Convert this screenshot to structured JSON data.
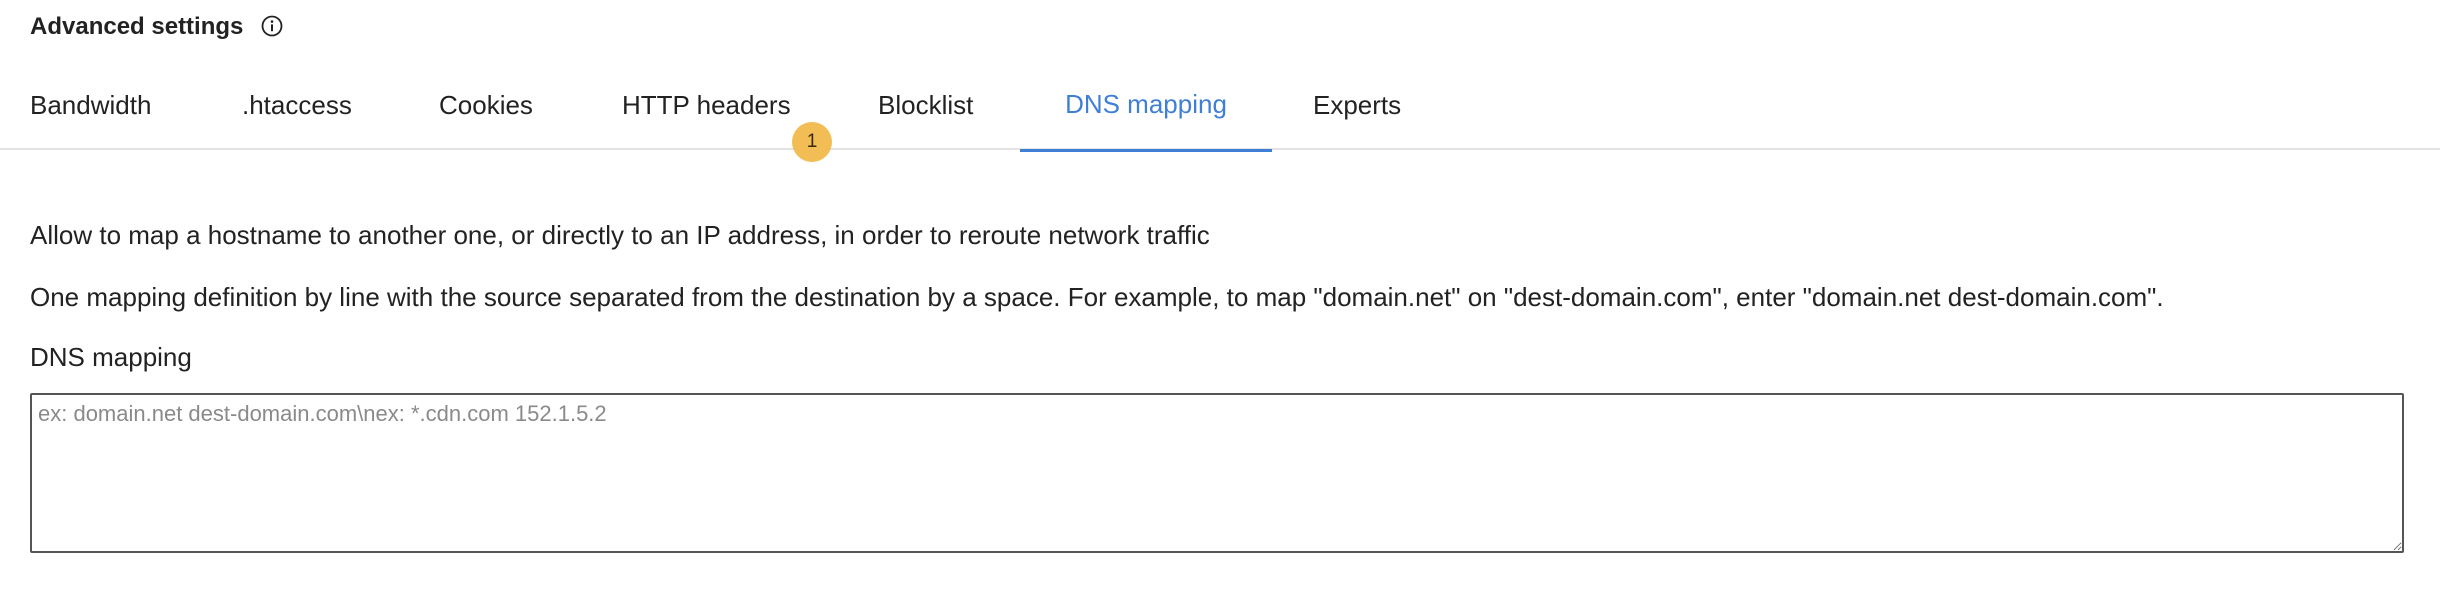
{
  "header": {
    "title": "Advanced settings",
    "info_icon": "info-circle-icon"
  },
  "tabs": [
    {
      "label": "Bandwidth",
      "active": false
    },
    {
      "label": ".htaccess",
      "active": false
    },
    {
      "label": "Cookies",
      "active": false
    },
    {
      "label": "HTTP headers",
      "active": false,
      "badge": "1"
    },
    {
      "label": "Blocklist",
      "active": false
    },
    {
      "label": "DNS mapping",
      "active": true
    },
    {
      "label": "Experts",
      "active": false
    }
  ],
  "content": {
    "description_1": "Allow to map a hostname to another one, or directly to an IP address, in order to reroute network traffic",
    "description_2": "One mapping definition by line with the source separated from the destination by a space. For example, to map \"domain.net\" on \"dest-domain.com\", enter \"domain.net dest-domain.com\".",
    "field_label": "DNS mapping",
    "field_value": "",
    "field_placeholder": "ex: domain.net dest-domain.com\\nex: *.cdn.com 152.1.5.2"
  },
  "colors": {
    "accent": "#3f7fd6",
    "badge": "#f2bd55",
    "divider": "#e3e3e3"
  }
}
